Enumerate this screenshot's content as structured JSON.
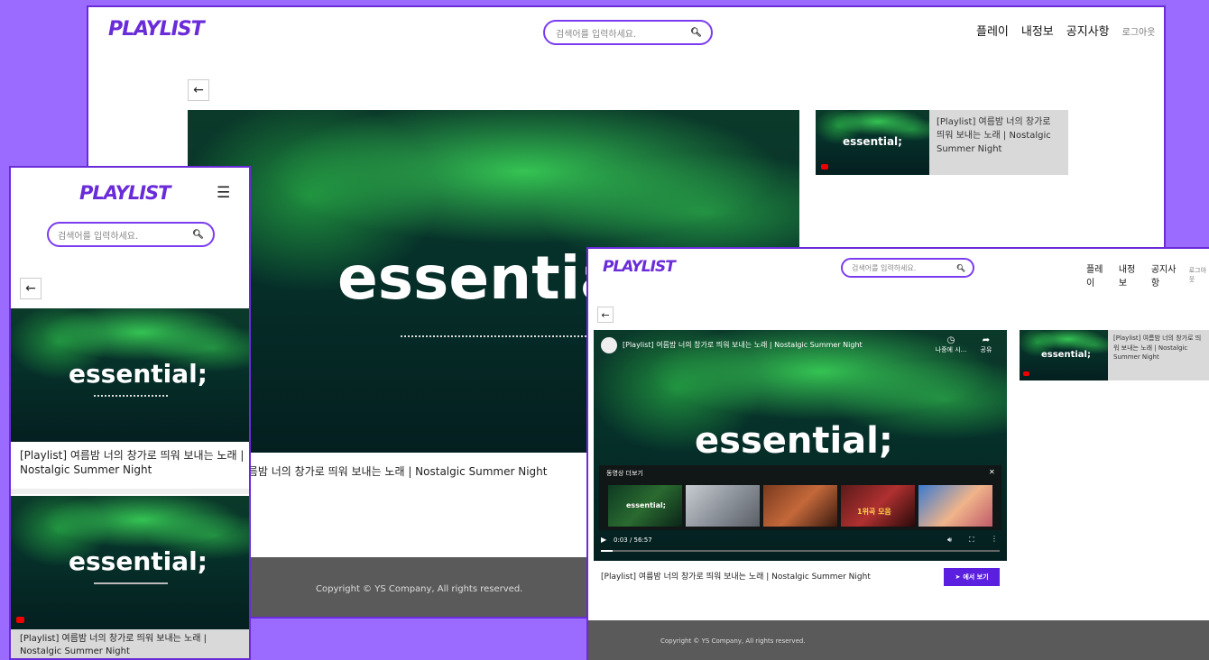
{
  "logo": "PLAYLIST",
  "search": {
    "placeholder": "검색어를 입력하세요."
  },
  "nav": {
    "items": [
      "플레이",
      "내정보",
      "공지사항"
    ],
    "logout": "로그아웃"
  },
  "video": {
    "brand": "essential;",
    "title": "[Playlist] 여름밤 너의 창가로 띄워 보내는 노래 | Nostalgic Summer Night",
    "title_mobile": "[Playlist] 여름밤 너의 창가로 띄워 보내는 노래 | Nostalgic Summer Night",
    "title_mobile_2": "[Playlist] 여름밤 너의 창가로 띄워 보내는 노래 | Nostalgic Summer Night",
    "side_title": "[Playlist] 여름밤 너의 창가로 띄워 보내는 노래 | Nostalgic Summer Night"
  },
  "player": {
    "header_title": "[Playlist] 여름밤 너의 창가로 띄워 보내는 노래 | Nostalgic Summer Night",
    "watch_later": "나중에 시...",
    "share": "공유",
    "more_videos": "동영상 더보기",
    "time": "0:03 / 56:57",
    "youtube_button": "에서 보기",
    "thumbs": [
      "essential;",
      "",
      "",
      "1위곡 모음",
      ""
    ]
  },
  "footer": {
    "copyright": "Copyright © YS Company, All rights reserved."
  }
}
